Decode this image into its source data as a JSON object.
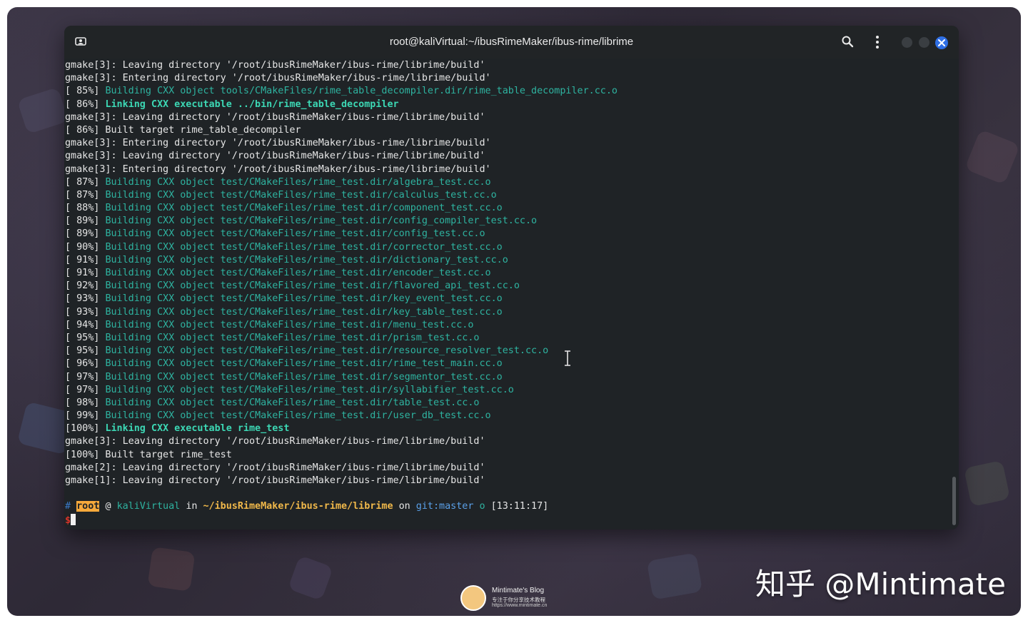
{
  "window": {
    "title": "root@kaliVirtual:~/ibusRimeMaker/ibus-rime/librime",
    "accent_close": "#2f6fe4"
  },
  "terminal": {
    "lines": [
      {
        "type": "plain",
        "text": "gmake[3]: Leaving directory '/root/ibusRimeMaker/ibus-rime/librime/build'"
      },
      {
        "type": "plain",
        "text": "gmake[3]: Entering directory '/root/ibusRimeMaker/ibus-rime/librime/build'"
      },
      {
        "type": "build",
        "pct": "[ 85%] ",
        "text": "Building CXX object tools/CMakeFiles/rime_table_decompiler.dir/rime_table_decompiler.cc.o"
      },
      {
        "type": "link",
        "pct": "[ 86%] ",
        "text": "Linking CXX executable ../bin/rime_table_decompiler"
      },
      {
        "type": "plain",
        "text": "gmake[3]: Leaving directory '/root/ibusRimeMaker/ibus-rime/librime/build'"
      },
      {
        "type": "plain",
        "text": "[ 86%] Built target rime_table_decompiler"
      },
      {
        "type": "plain",
        "text": "gmake[3]: Entering directory '/root/ibusRimeMaker/ibus-rime/librime/build'"
      },
      {
        "type": "plain",
        "text": "gmake[3]: Leaving directory '/root/ibusRimeMaker/ibus-rime/librime/build'"
      },
      {
        "type": "plain",
        "text": "gmake[3]: Entering directory '/root/ibusRimeMaker/ibus-rime/librime/build'"
      },
      {
        "type": "build",
        "pct": "[ 87%] ",
        "text": "Building CXX object test/CMakeFiles/rime_test.dir/algebra_test.cc.o"
      },
      {
        "type": "build",
        "pct": "[ 87%] ",
        "text": "Building CXX object test/CMakeFiles/rime_test.dir/calculus_test.cc.o"
      },
      {
        "type": "build",
        "pct": "[ 88%] ",
        "text": "Building CXX object test/CMakeFiles/rime_test.dir/component_test.cc.o"
      },
      {
        "type": "build",
        "pct": "[ 89%] ",
        "text": "Building CXX object test/CMakeFiles/rime_test.dir/config_compiler_test.cc.o"
      },
      {
        "type": "build",
        "pct": "[ 89%] ",
        "text": "Building CXX object test/CMakeFiles/rime_test.dir/config_test.cc.o"
      },
      {
        "type": "build",
        "pct": "[ 90%] ",
        "text": "Building CXX object test/CMakeFiles/rime_test.dir/corrector_test.cc.o"
      },
      {
        "type": "build",
        "pct": "[ 91%] ",
        "text": "Building CXX object test/CMakeFiles/rime_test.dir/dictionary_test.cc.o"
      },
      {
        "type": "build",
        "pct": "[ 91%] ",
        "text": "Building CXX object test/CMakeFiles/rime_test.dir/encoder_test.cc.o"
      },
      {
        "type": "build",
        "pct": "[ 92%] ",
        "text": "Building CXX object test/CMakeFiles/rime_test.dir/flavored_api_test.cc.o"
      },
      {
        "type": "build",
        "pct": "[ 93%] ",
        "text": "Building CXX object test/CMakeFiles/rime_test.dir/key_event_test.cc.o"
      },
      {
        "type": "build",
        "pct": "[ 93%] ",
        "text": "Building CXX object test/CMakeFiles/rime_test.dir/key_table_test.cc.o"
      },
      {
        "type": "build",
        "pct": "[ 94%] ",
        "text": "Building CXX object test/CMakeFiles/rime_test.dir/menu_test.cc.o"
      },
      {
        "type": "build",
        "pct": "[ 95%] ",
        "text": "Building CXX object test/CMakeFiles/rime_test.dir/prism_test.cc.o"
      },
      {
        "type": "build",
        "pct": "[ 95%] ",
        "text": "Building CXX object test/CMakeFiles/rime_test.dir/resource_resolver_test.cc.o"
      },
      {
        "type": "build",
        "pct": "[ 96%] ",
        "text": "Building CXX object test/CMakeFiles/rime_test.dir/rime_test_main.cc.o"
      },
      {
        "type": "build",
        "pct": "[ 97%] ",
        "text": "Building CXX object test/CMakeFiles/rime_test.dir/segmentor_test.cc.o"
      },
      {
        "type": "build",
        "pct": "[ 97%] ",
        "text": "Building CXX object test/CMakeFiles/rime_test.dir/syllabifier_test.cc.o"
      },
      {
        "type": "build",
        "pct": "[ 98%] ",
        "text": "Building CXX object test/CMakeFiles/rime_test.dir/table_test.cc.o"
      },
      {
        "type": "build",
        "pct": "[ 99%] ",
        "text": "Building CXX object test/CMakeFiles/rime_test.dir/user_db_test.cc.o"
      },
      {
        "type": "link",
        "pct": "[100%] ",
        "text": "Linking CXX executable rime_test"
      },
      {
        "type": "plain",
        "text": "gmake[3]: Leaving directory '/root/ibusRimeMaker/ibus-rime/librime/build'"
      },
      {
        "type": "plain",
        "text": "[100%] Built target rime_test"
      },
      {
        "type": "plain",
        "text": "gmake[2]: Leaving directory '/root/ibusRimeMaker/ibus-rime/librime/build'"
      },
      {
        "type": "plain",
        "text": "gmake[1]: Leaving directory '/root/ibusRimeMaker/ibus-rime/librime/build'"
      }
    ],
    "prompt": {
      "hash": "#",
      "user": "root",
      "at": "@",
      "host": "kaliVirtual",
      "in": "in",
      "path": "~/ibusRimeMaker/ibus-rime/librime",
      "on": "on",
      "git": "git:master",
      "status": "o",
      "time": "[13:11:17]",
      "dollar": "$"
    },
    "colors": {
      "build": "#2eb3a0",
      "link": "#3cd7b4",
      "user_bg": "#f6a93b",
      "path": "#f0b84a",
      "git": "#5aa0e8",
      "dollar": "#d9352a"
    }
  },
  "icons": {
    "newtab": "new-tab-icon",
    "search": "search-icon",
    "menu": "kebab-menu-icon",
    "close": "close-icon"
  },
  "watermark": {
    "zhihu": "知乎 @Mintimate",
    "blog_name": "Mintimate's Blog",
    "blog_slogan": "专注于你分享技术教程",
    "blog_url": "https://www.mintimate.cn"
  }
}
